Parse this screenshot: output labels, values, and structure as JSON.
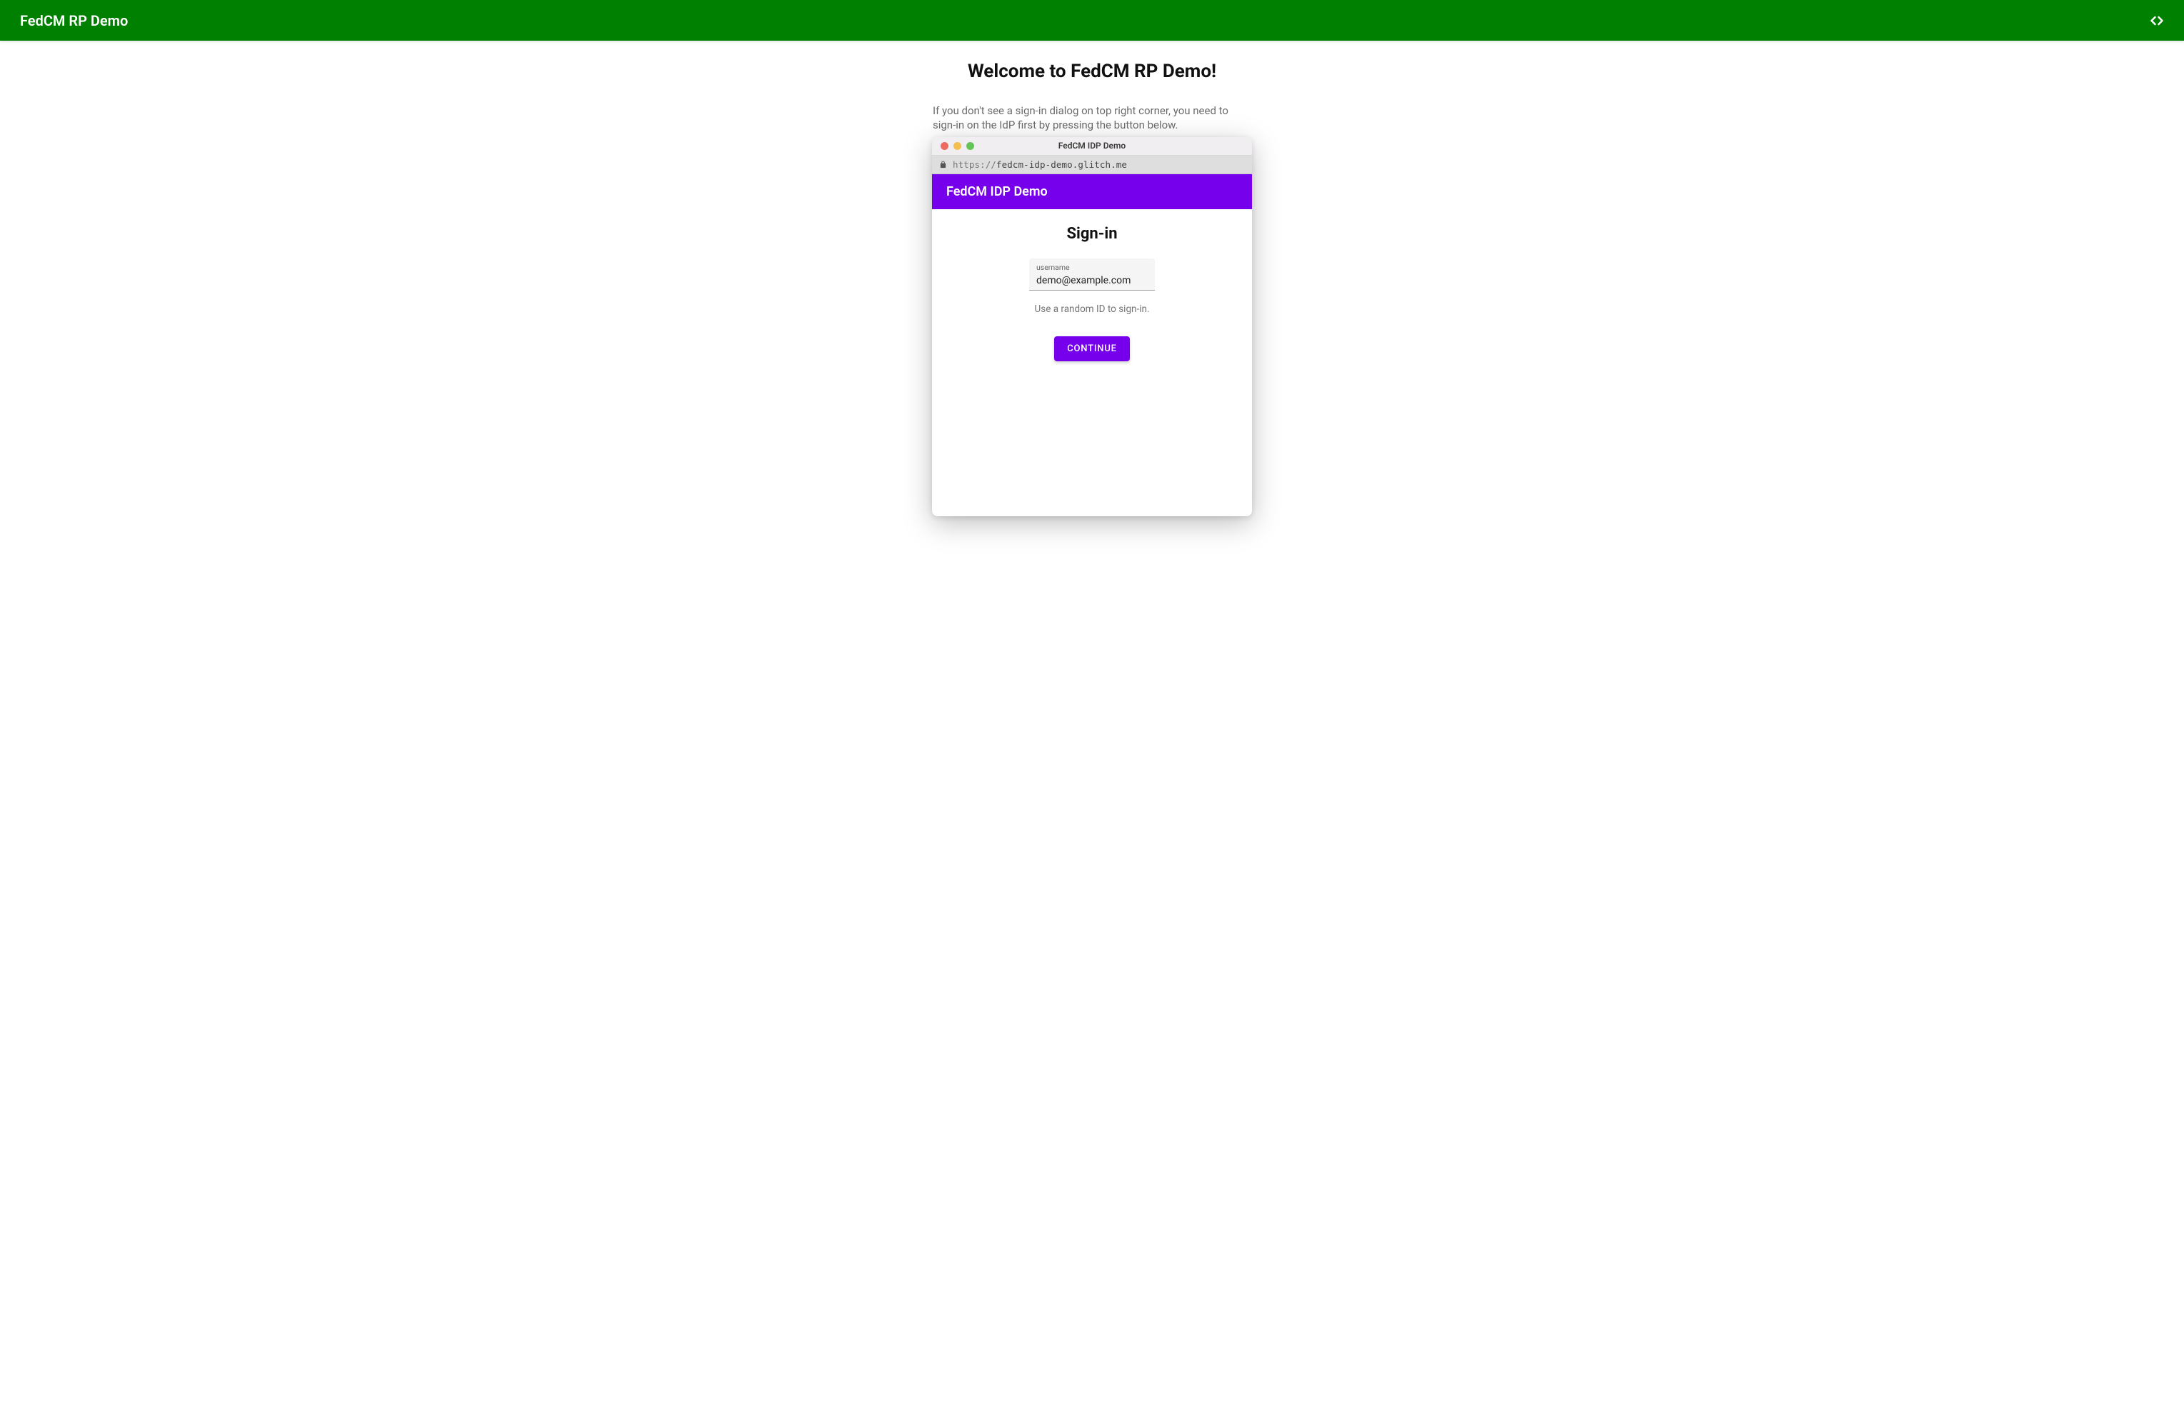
{
  "outer": {
    "header_title": "FedCM RP Demo",
    "page_title": "Welcome to FedCM RP Demo!",
    "instruction": "If you don't see a sign-in dialog on top right corner, you need to sign-in on the IdP first by pressing the button below."
  },
  "popup": {
    "window_title": "FedCM IDP Demo",
    "url_proto": "https://",
    "url_host": "fedcm-idp-demo.glitch.me",
    "inner_header": "FedCM IDP Demo",
    "signin_title": "Sign-in",
    "username_label": "username",
    "username_value": "demo@example.com",
    "helper_text": "Use a random ID to sign-in.",
    "continue_label": "CONTINUE"
  },
  "colors": {
    "outer_accent": "#008000",
    "inner_accent": "#7600EB"
  }
}
